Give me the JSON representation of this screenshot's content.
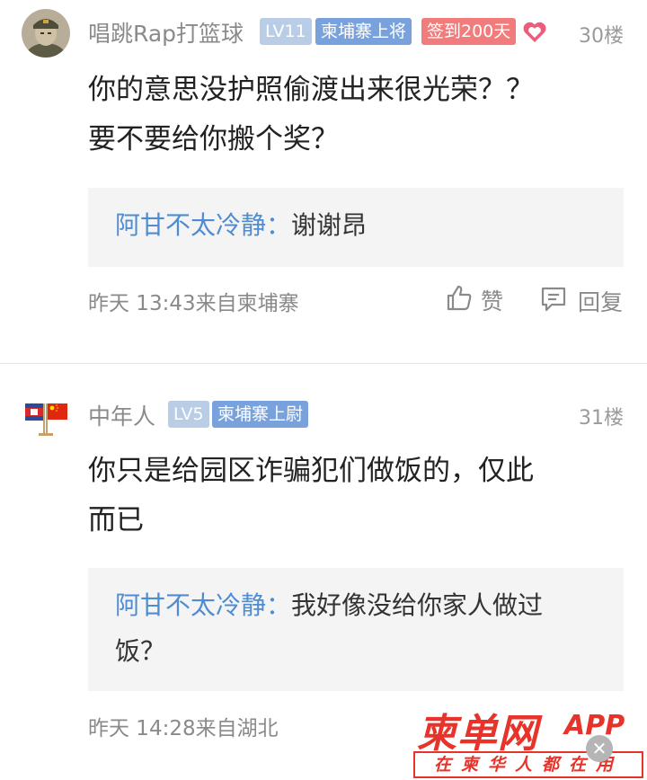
{
  "posts": [
    {
      "username": "唱跳Rap打篮球",
      "level": "LV11",
      "rank": "柬埔寨上将",
      "checkin": "签到200天",
      "floor": "30楼",
      "content_lines": [
        "你的意思没护照偷渡出来很光荣？？",
        "要不要给你搬个奖？"
      ],
      "reply": {
        "author": "阿甘不太冷静：",
        "text": "谢谢昂"
      },
      "meta": "昨天 13:43来自柬埔寨",
      "like_label": "赞",
      "reply_label": "回复"
    },
    {
      "username": "中年人",
      "level": "LV5",
      "rank": "柬埔寨上尉",
      "floor": "31楼",
      "content_lines": [
        "你只是给园区诈骗犯们做饭的，仅此",
        "而已"
      ],
      "reply": {
        "author": "阿甘不太冷静：",
        "text_lines": [
          "我好像没给你家人做过",
          "饭？"
        ]
      },
      "meta": "昨天 14:28来自湖北"
    }
  ],
  "watermark": {
    "main": "柬单网",
    "app": "APP",
    "slogan": "在柬华人都在用"
  },
  "colors": {
    "link_blue": "#4f8cd1",
    "rank_badge": "#79a2dc",
    "level_badge": "#b9cde6",
    "checkin_badge": "#f27b7b",
    "brand_red": "#e8332b"
  },
  "icons": [
    "heart-icon",
    "thumbs-up-icon",
    "comment-icon",
    "close-icon",
    "flag-icon"
  ]
}
